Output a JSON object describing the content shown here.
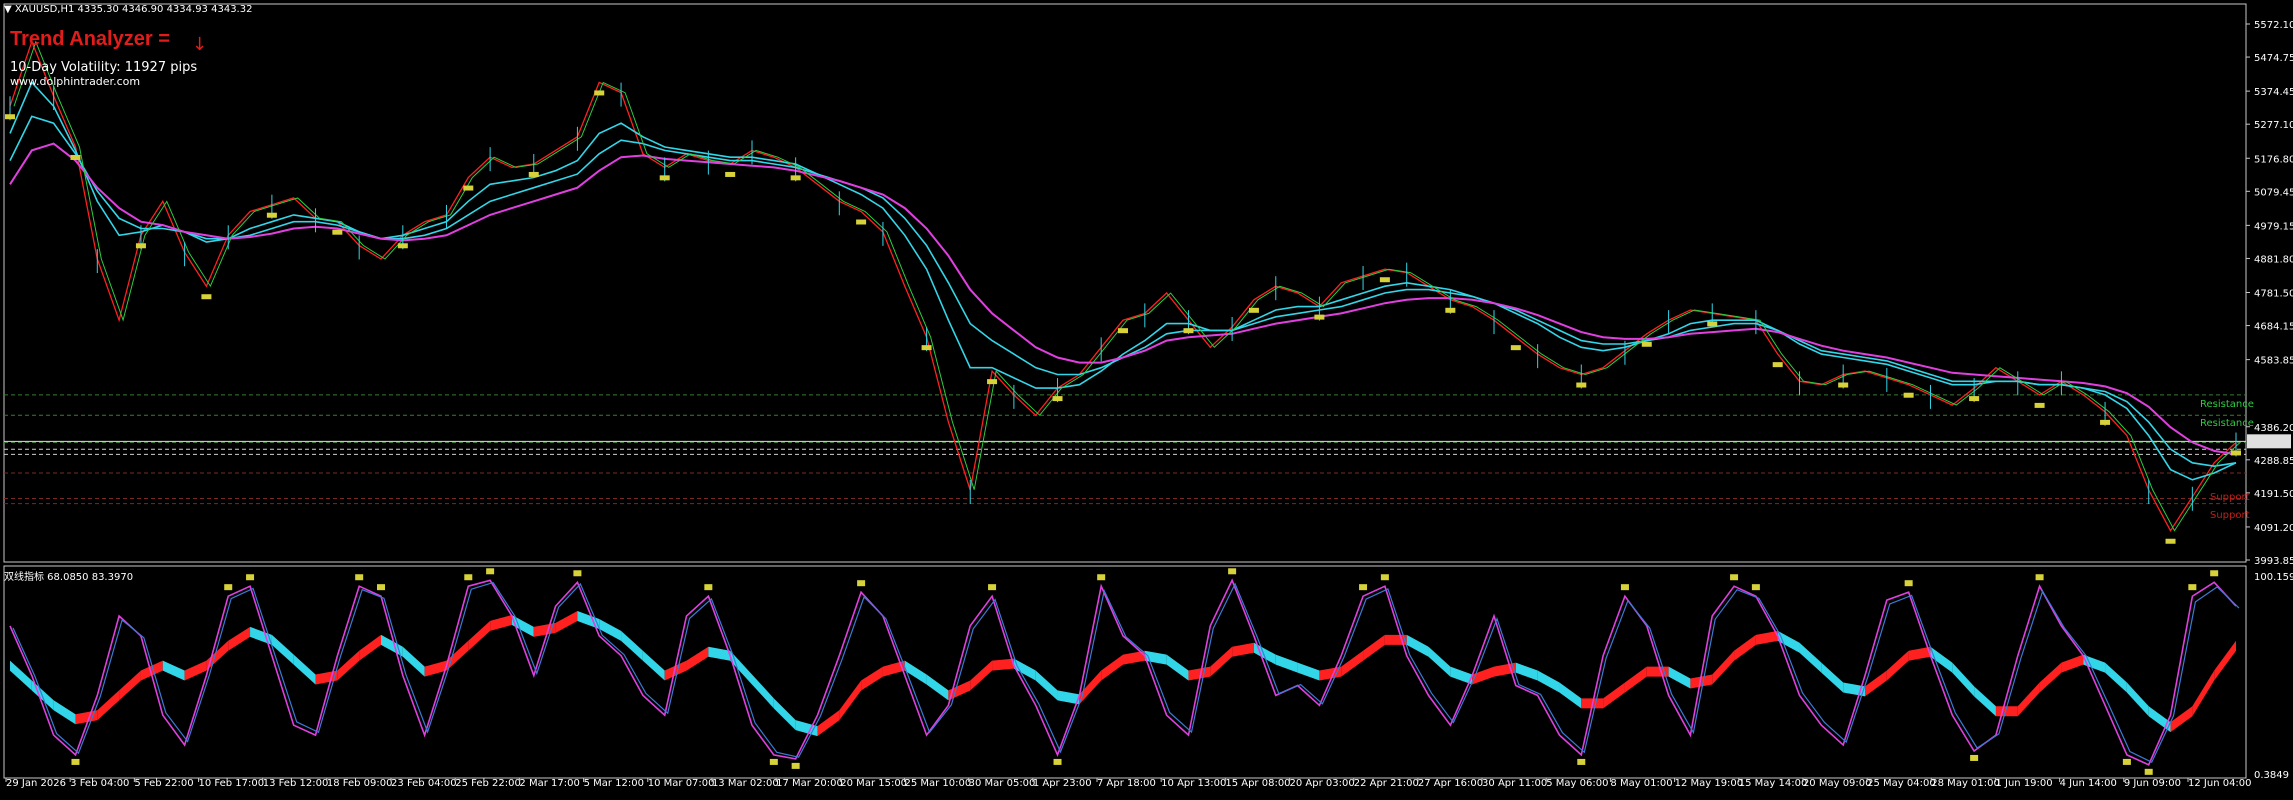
{
  "header": {
    "symbol_line": "XAUUSD,H1  4335.30 4346.90 4334.93 4343.32"
  },
  "indicator_panel": {
    "title": "Trend Analyzer =",
    "trend_arrow": "↓",
    "volatility": "10-Day Volatility: 11927 pips",
    "website": "www.dolphintrader.com"
  },
  "oscillator_header": "双线指标 68.0850 83.3970",
  "levels": {
    "resistance_label": "Resistance",
    "support_label": "Support"
  },
  "colors": {
    "background": "#000000",
    "grid": "#3a3a3a",
    "cyan": "#33d6e8",
    "magenta": "#e040e0",
    "red": "#ff2020",
    "green": "#2ecc40",
    "orange": "#ff6a1a",
    "yellow_label": "#d8d23a",
    "white": "#ffffff"
  },
  "chart_data": [
    {
      "type": "line",
      "title": "XAUUSD,H1",
      "ylim": [
        3993.85,
        5572.1
      ],
      "y_ticks": [
        "5572.10",
        "5474.75",
        "5374.45",
        "5277.10",
        "5176.80",
        "5079.45",
        "4979.15",
        "4881.80",
        "4781.50",
        "4684.15",
        "4583.85",
        "4386.20",
        "4288.85",
        "4191.50",
        "4091.20",
        "3993.85"
      ],
      "x_ticks": [
        "29 Jan 2026",
        "3 Feb 04:00",
        "5 Feb 22:00",
        "10 Feb 17:00",
        "13 Feb 12:00",
        "18 Feb 09:00",
        "23 Feb 04:00",
        "25 Feb 22:00",
        "2 Mar 17:00",
        "5 Mar 12:00",
        "10 Mar 07:00",
        "13 Mar 02:00",
        "17 Mar 20:00",
        "20 Mar 15:00",
        "25 Mar 10:00",
        "30 Mar 05:00",
        "1 Apr 23:00",
        "7 Apr 18:00",
        "10 Apr 13:00",
        "15 Apr 08:00",
        "20 Apr 03:00",
        "22 Apr 21:00",
        "27 Apr 16:00",
        "30 Apr 11:00",
        "5 May 06:00",
        "8 May 01:00",
        "12 May 19:00",
        "15 May 14:00",
        "20 May 09:00",
        "25 May 04:00",
        "28 May 01:00",
        "1 Jun 19:00",
        "4 Jun 14:00",
        "9 Jun 09:00",
        "12 Jun 04:00"
      ],
      "series": [
        {
          "values": [
            5330,
            5520,
            5360,
            5210,
            4880,
            4700,
            4950,
            5050,
            4900,
            4800,
            4950,
            5020,
            5040,
            5060,
            5000,
            4990,
            4920,
            4880,
            4950,
            4990,
            5010,
            5120,
            5180,
            5150,
            5160,
            5200,
            5240,
            5400,
            5370,
            5190,
            5150,
            5190,
            5170,
            5160,
            5200,
            5180,
            5150,
            5100,
            5050,
            5020,
            4960,
            4800,
            4650,
            4400,
            4200,
            4550,
            4480,
            4420,
            4500,
            4540,
            4620,
            4700,
            4720,
            4780,
            4700,
            4620,
            4680,
            4760,
            4800,
            4780,
            4740,
            4810,
            4830,
            4850,
            4840,
            4800,
            4760,
            4740,
            4700,
            4650,
            4600,
            4560,
            4540,
            4560,
            4610,
            4660,
            4700,
            4730,
            4720,
            4710,
            4700,
            4600,
            4520,
            4510,
            4540,
            4550,
            4530,
            4510,
            4480,
            4450,
            4500,
            4560,
            4520,
            4480,
            4520,
            4480,
            4430,
            4360,
            4200,
            4080,
            4180,
            4280,
            4340
          ]
        },
        {
          "values": [
            5250,
            5400,
            5330,
            5200,
            5050,
            4950,
            4960,
            4980,
            4960,
            4930,
            4940,
            4970,
            4990,
            5010,
            5000,
            4990,
            4960,
            4940,
            4950,
            4970,
            4990,
            5050,
            5100,
            5110,
            5120,
            5140,
            5170,
            5250,
            5280,
            5240,
            5210,
            5200,
            5190,
            5180,
            5180,
            5170,
            5160,
            5130,
            5100,
            5070,
            5030,
            4950,
            4850,
            4700,
            4560,
            4560,
            4530,
            4500,
            4500,
            4510,
            4550,
            4600,
            4640,
            4690,
            4690,
            4670,
            4670,
            4700,
            4730,
            4740,
            4740,
            4760,
            4780,
            4800,
            4810,
            4800,
            4790,
            4770,
            4750,
            4720,
            4690,
            4650,
            4620,
            4610,
            4620,
            4640,
            4660,
            4690,
            4700,
            4700,
            4700,
            4670,
            4630,
            4600,
            4590,
            4580,
            4570,
            4550,
            4530,
            4510,
            4510,
            4520,
            4520,
            4510,
            4510,
            4500,
            4480,
            4440,
            4360,
            4260,
            4230,
            4250,
            4280
          ]
        },
        {
          "values": [
            5170,
            5300,
            5280,
            5190,
            5080,
            5000,
            4970,
            4970,
            4960,
            4940,
            4940,
            4950,
            4970,
            4990,
            4990,
            4980,
            4960,
            4940,
            4940,
            4950,
            4970,
            5010,
            5050,
            5070,
            5090,
            5110,
            5130,
            5190,
            5230,
            5220,
            5200,
            5190,
            5180,
            5170,
            5170,
            5160,
            5150,
            5130,
            5110,
            5090,
            5060,
            5000,
            4920,
            4810,
            4690,
            4640,
            4600,
            4560,
            4540,
            4540,
            4560,
            4590,
            4620,
            4660,
            4670,
            4670,
            4670,
            4690,
            4710,
            4720,
            4730,
            4740,
            4760,
            4780,
            4790,
            4790,
            4780,
            4770,
            4750,
            4730,
            4700,
            4670,
            4640,
            4630,
            4630,
            4640,
            4650,
            4670,
            4680,
            4690,
            4690,
            4670,
            4640,
            4610,
            4600,
            4590,
            4580,
            4560,
            4540,
            4520,
            4520,
            4520,
            4520,
            4510,
            4510,
            4500,
            4490,
            4460,
            4400,
            4320,
            4280,
            4270,
            4280
          ]
        },
        {
          "values": [
            5100,
            5200,
            5220,
            5170,
            5090,
            5030,
            4990,
            4980,
            4960,
            4950,
            4940,
            4945,
            4955,
            4970,
            4975,
            4970,
            4955,
            4940,
            4935,
            4940,
            4950,
            4980,
            5010,
            5030,
            5050,
            5070,
            5090,
            5140,
            5180,
            5185,
            5175,
            5170,
            5165,
            5160,
            5155,
            5150,
            5140,
            5125,
            5110,
            5090,
            5070,
            5030,
            4970,
            4890,
            4790,
            4720,
            4670,
            4620,
            4590,
            4575,
            4575,
            4590,
            4610,
            4640,
            4650,
            4655,
            4660,
            4675,
            4690,
            4700,
            4710,
            4720,
            4735,
            4750,
            4760,
            4765,
            4765,
            4760,
            4750,
            4735,
            4715,
            4690,
            4665,
            4650,
            4645,
            4645,
            4650,
            4660,
            4665,
            4670,
            4675,
            4665,
            4645,
            4625,
            4610,
            4600,
            4590,
            4575,
            4560,
            4545,
            4540,
            4535,
            4530,
            4525,
            4520,
            4515,
            4505,
            4485,
            4445,
            4385,
            4340,
            4315,
            4305
          ]
        }
      ],
      "horizontal_levels": [
        4480,
        4420,
        4340,
        4320,
        4305,
        4250,
        4175,
        4160
      ],
      "last_price": 4343.32
    },
    {
      "type": "line",
      "title": "双线指标 68.0850 83.3970",
      "ylim": [
        0.3849,
        100.1596
      ],
      "y_ticks": [
        "100.1596",
        "0.3849"
      ],
      "series": [
        {
          "values": [
            75,
            50,
            20,
            10,
            40,
            80,
            70,
            30,
            15,
            50,
            90,
            95,
            60,
            25,
            20,
            60,
            95,
            90,
            50,
            20,
            55,
            95,
            98,
            80,
            50,
            85,
            97,
            70,
            60,
            40,
            30,
            80,
            90,
            60,
            25,
            10,
            8,
            30,
            60,
            92,
            80,
            50,
            20,
            35,
            75,
            90,
            55,
            35,
            10,
            40,
            95,
            70,
            60,
            30,
            20,
            75,
            98,
            70,
            40,
            45,
            35,
            60,
            90,
            95,
            60,
            40,
            25,
            50,
            80,
            45,
            40,
            20,
            10,
            60,
            90,
            75,
            40,
            20,
            80,
            95,
            90,
            70,
            40,
            25,
            15,
            50,
            88,
            92,
            60,
            30,
            12,
            20,
            60,
            95,
            75,
            60,
            35,
            10,
            5,
            30,
            90,
            97,
            85
          ]
        },
        {
          "values": [
            55,
            45,
            35,
            28,
            30,
            40,
            50,
            55,
            50,
            55,
            65,
            72,
            68,
            58,
            48,
            50,
            60,
            68,
            62,
            52,
            55,
            65,
            75,
            78,
            72,
            74,
            80,
            76,
            70,
            60,
            50,
            55,
            62,
            60,
            48,
            36,
            25,
            22,
            30,
            45,
            52,
            55,
            48,
            40,
            45,
            55,
            56,
            50,
            40,
            38,
            50,
            58,
            60,
            58,
            50,
            52,
            62,
            64,
            58,
            54,
            50,
            52,
            60,
            68,
            68,
            62,
            52,
            48,
            52,
            54,
            50,
            44,
            36,
            36,
            44,
            52,
            52,
            46,
            48,
            60,
            68,
            70,
            64,
            54,
            44,
            42,
            50,
            60,
            62,
            54,
            42,
            32,
            32,
            44,
            54,
            58,
            54,
            44,
            32,
            24,
            32,
            50,
            65
          ]
        }
      ]
    }
  ]
}
